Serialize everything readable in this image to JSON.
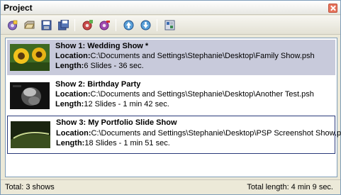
{
  "panel": {
    "title": "Project"
  },
  "toolbar": {
    "buttons": [
      {
        "icon": "new-show-icon"
      },
      {
        "icon": "open-show-icon"
      },
      {
        "icon": "save-icon"
      },
      {
        "icon": "save-all-icon"
      },
      {
        "icon": "add-show-icon"
      },
      {
        "icon": "remove-show-icon"
      },
      {
        "icon": "move-up-icon"
      },
      {
        "icon": "move-down-icon"
      },
      {
        "icon": "properties-icon"
      }
    ]
  },
  "shows": [
    {
      "title": "Show 1: Wedding Show *",
      "location_label": "Location:",
      "location": "C:\\Documents and Settings\\Stephanie\\Desktop\\Family Show.psh",
      "length_label": "Length:",
      "length": "6 Slides - 36 sec.",
      "thumbnail": "sunflower"
    },
    {
      "title": "Show 2: Birthday Party",
      "location_label": "Location:",
      "location": "C:\\Documents and Settings\\Stephanie\\Desktop\\Another Test.psh",
      "length_label": "Length:",
      "length": "12 Slides - 1 min 42 sec.",
      "thumbnail": "dark-photo"
    },
    {
      "title": "Show 3:   My Portfolio Slide Show",
      "location_label": "Location:",
      "location": "C:\\Documents and Settings\\Stephanie\\Desktop\\PSP Screenshot Show.psh",
      "length_label": "Length:",
      "length": "18 Slides - 1 min 51 sec.",
      "thumbnail": "green-curve"
    }
  ],
  "status": {
    "total_shows": "Total: 3 shows",
    "total_length": "Total length: 4 min 9 sec."
  },
  "colors": {
    "selected_row": "#c8cadb",
    "focus_border": "#2a3a7a",
    "panel_bg": "#ece9d8"
  }
}
